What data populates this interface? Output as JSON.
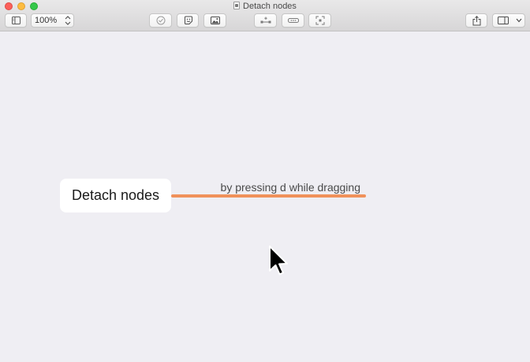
{
  "window": {
    "title": "Detach nodes"
  },
  "toolbar": {
    "zoom_value": "100%",
    "buttons": [
      {
        "name": "sidebar-toggle-button",
        "icon": "sidebar-icon"
      },
      {
        "name": "task-button",
        "icon": "checkmark-circle-icon"
      },
      {
        "name": "sticker-button",
        "icon": "sticker-icon"
      },
      {
        "name": "image-button",
        "icon": "image-icon"
      },
      {
        "name": "add-child-button",
        "icon": "add-child-node-icon"
      },
      {
        "name": "add-sibling-button",
        "icon": "add-sibling-node-icon"
      },
      {
        "name": "focus-button",
        "icon": "focus-icon"
      },
      {
        "name": "share-button",
        "icon": "share-icon"
      },
      {
        "name": "inspector-toggle-button",
        "icon": "inspector-icon"
      }
    ]
  },
  "canvas": {
    "node": {
      "label": "Detach nodes"
    },
    "connector": {
      "label": "by pressing d while dragging",
      "color": "#f0915a"
    }
  },
  "colors": {
    "canvas_background": "#efeef3",
    "node_background": "#ffffff",
    "connector": "#f0915a"
  }
}
